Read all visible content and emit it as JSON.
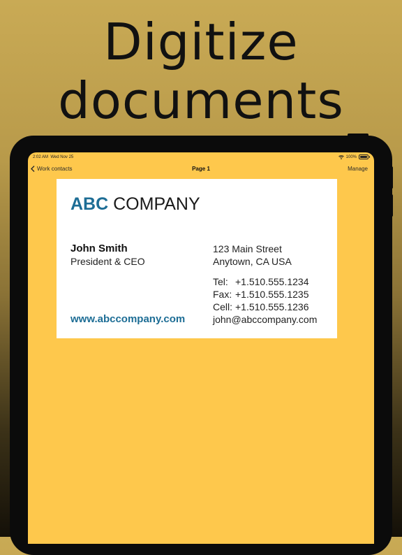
{
  "headline": {
    "line1": "Digitize",
    "line2": "documents"
  },
  "status_bar": {
    "time": "2:02 AM",
    "date": "Wed Nov 25",
    "battery": "100%"
  },
  "nav": {
    "back_label": "Work contacts",
    "title": "Page 1",
    "action_label": "Manage"
  },
  "card": {
    "logo_bold": "ABC",
    "logo_rest": " COMPANY",
    "name": "John Smith",
    "title": "President & CEO",
    "website": "www.abccompany.com",
    "address_line1": "123 Main Street",
    "address_line2": "Anytown, CA USA",
    "tel_label": "Tel:",
    "tel": "+1.510.555.1234",
    "fax_label": "Fax:",
    "fax": "+1.510.555.1235",
    "cell_label": "Cell:",
    "cell": "+1.510.555.1236",
    "email": "john@abccompany.com"
  },
  "colors": {
    "screen_bg": "#fec84c",
    "brand_blue": "#1d6d95"
  },
  "icons": {
    "back": "chevron-left-icon",
    "wifi": "wifi-icon",
    "battery": "battery-icon"
  }
}
